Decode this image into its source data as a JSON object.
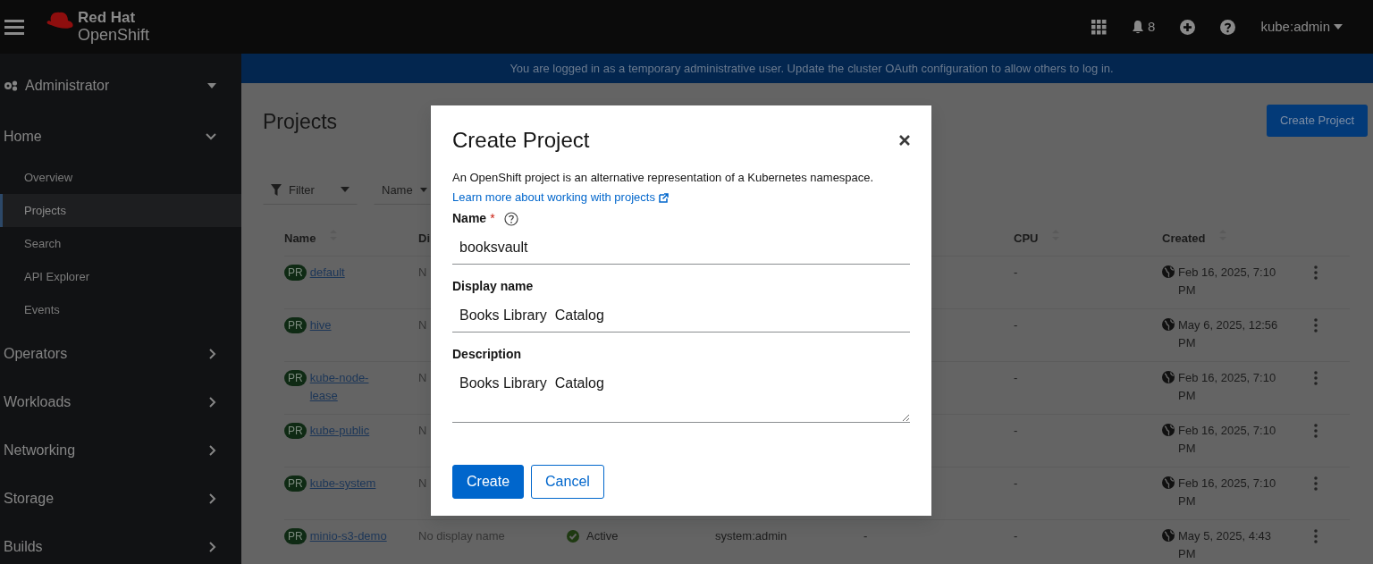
{
  "masthead": {
    "logo_line1": "Red Hat",
    "logo_line2": "OpenShift",
    "notifications": "8",
    "user": "kube:admin"
  },
  "banner": {
    "text_before": "You are logged in as a temporary administrative user. Update the",
    "link": "cluster OAuth configuration",
    "text_after": "to allow others to log in."
  },
  "sidebar": {
    "perspective": "Administrator",
    "nav": [
      {
        "label": "Home",
        "expanded": true,
        "children": [
          {
            "label": "Overview",
            "selected": false
          },
          {
            "label": "Projects",
            "selected": true
          },
          {
            "label": "Search",
            "selected": false
          },
          {
            "label": "API Explorer",
            "selected": false
          },
          {
            "label": "Events",
            "selected": false
          }
        ]
      },
      {
        "label": "Operators",
        "expanded": false
      },
      {
        "label": "Workloads",
        "expanded": false
      },
      {
        "label": "Networking",
        "expanded": false
      },
      {
        "label": "Storage",
        "expanded": false
      },
      {
        "label": "Builds",
        "expanded": false
      }
    ]
  },
  "page": {
    "title": "Projects",
    "create_button": "Create Project",
    "filter": "Filter",
    "search_attribute": "Name"
  },
  "table": {
    "columns": [
      {
        "label": "Name"
      },
      {
        "label": "Di"
      },
      {
        "label": "CPU"
      },
      {
        "label": "Created"
      }
    ],
    "rows": [
      {
        "badge": "PR",
        "name": "default",
        "display_name": "N",
        "cpu": "-",
        "created": "Feb 16, 2025, 7:10 PM"
      },
      {
        "badge": "PR",
        "name": "hive",
        "display_name": "N",
        "cpu": "-",
        "created": "May 6, 2025, 12:56 PM"
      },
      {
        "badge": "PR",
        "name": "kube-node-lease",
        "display_name": "N",
        "cpu": "-",
        "created": "Feb 16, 2025, 7:10 PM"
      },
      {
        "badge": "PR",
        "name": "kube-public",
        "display_name": "N",
        "cpu": "-",
        "created": "Feb 16, 2025, 7:10 PM"
      },
      {
        "badge": "PR",
        "name": "kube-system",
        "display_name": "N",
        "cpu": "-",
        "created": "Feb 16, 2025, 7:10 PM"
      },
      {
        "badge": "PR",
        "name": "minio-s3-demo",
        "display_name": "No display name",
        "status": "Active",
        "requester": "system:admin",
        "memory": "-",
        "cpu": "-",
        "created": "May 5, 2025, 4:43 PM"
      }
    ]
  },
  "modal": {
    "title": "Create Project",
    "description": "An OpenShift project is an alternative representation of a Kubernetes namespace.",
    "link": "Learn more about working with projects",
    "fields": [
      {
        "kind": "input",
        "label": "Name",
        "required_mark": "*",
        "help": true,
        "value": "booksvault"
      },
      {
        "kind": "input",
        "label": "Display name",
        "help": false,
        "value": "Books Library  Catalog"
      },
      {
        "kind": "textarea",
        "label": "Description",
        "help": false,
        "value": "Books Library  Catalog"
      }
    ],
    "buttons": [
      {
        "kind": "primary",
        "label": "Create"
      },
      {
        "kind": "secondary",
        "label": "Cancel"
      }
    ]
  }
}
